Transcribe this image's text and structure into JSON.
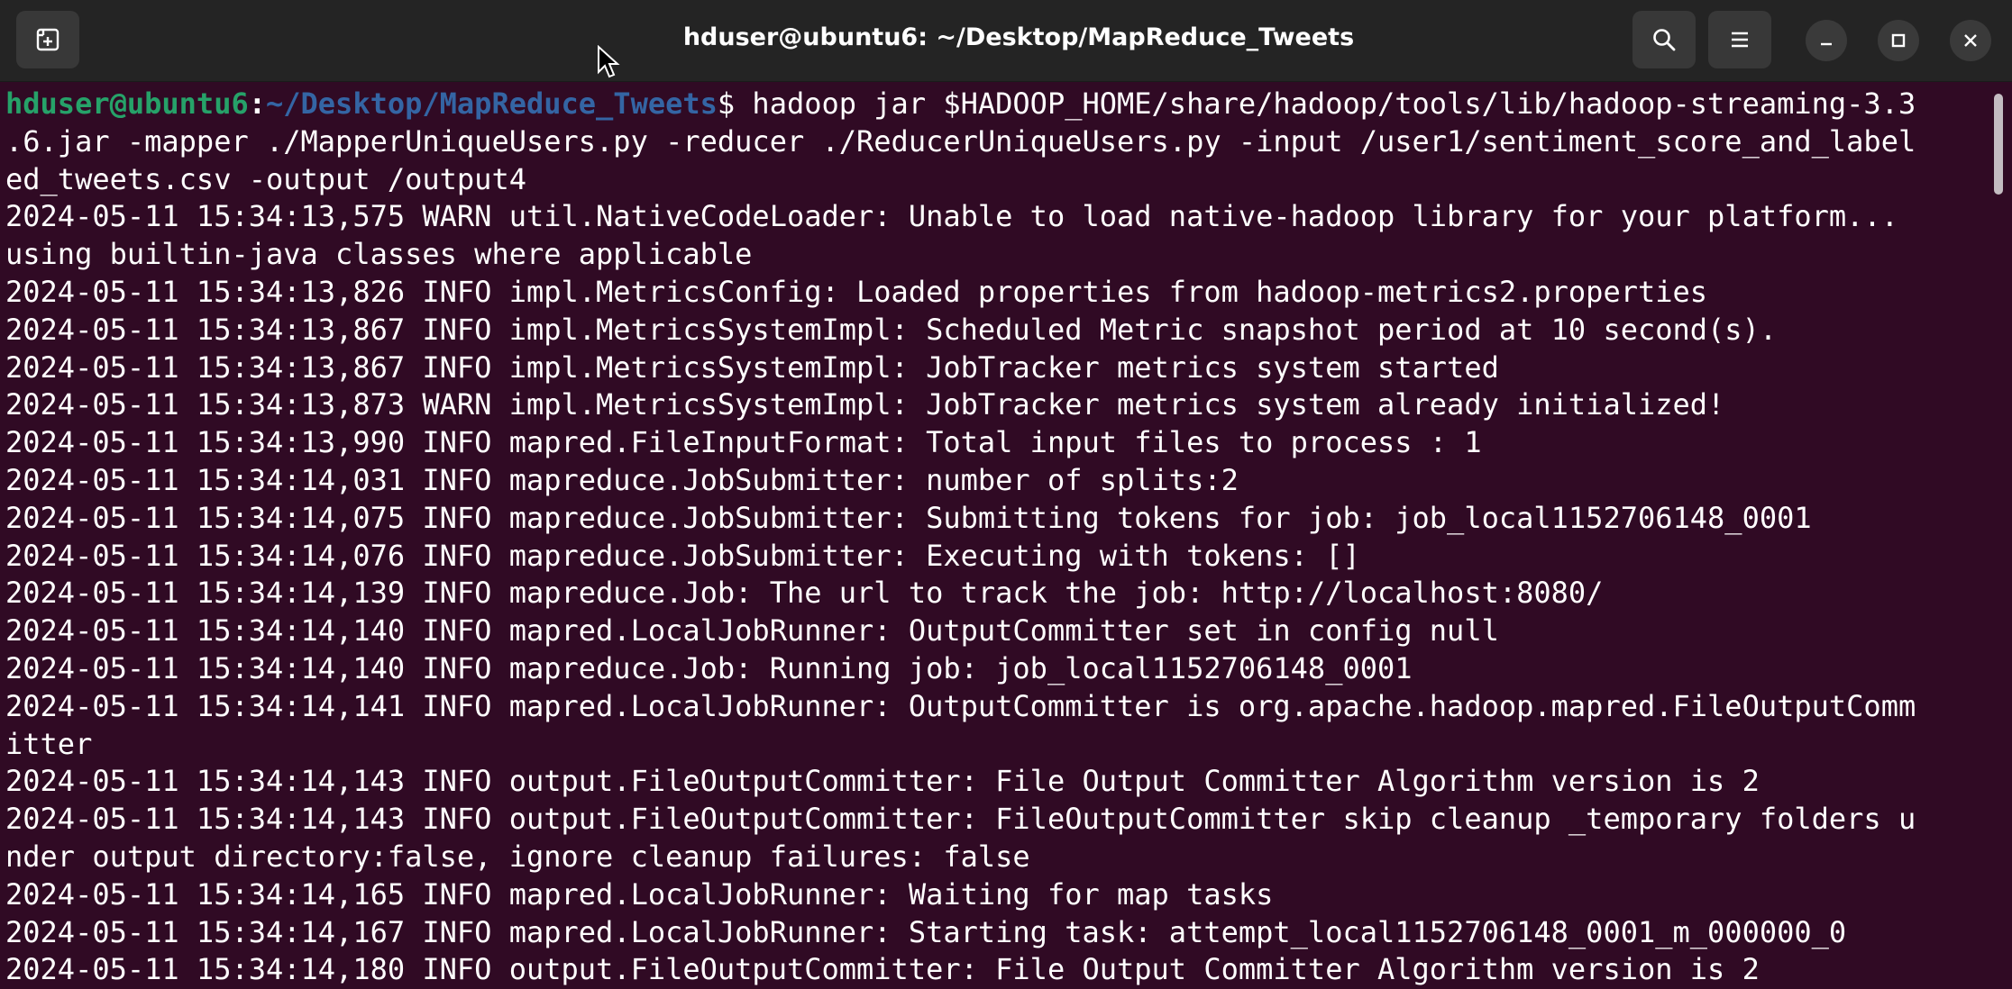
{
  "window": {
    "title": "hduser@ubuntu6: ~/Desktop/MapReduce_Tweets",
    "icons": {
      "new_tab": "new-tab-icon",
      "search": "search-icon",
      "menu": "hamburger-menu-icon",
      "minimize": "minimize-icon",
      "maximize": "maximize-icon",
      "close": "close-icon"
    }
  },
  "colors": {
    "background": "#300a24",
    "headerbar": "#242424",
    "prompt_user": "#26a269",
    "prompt_path": "#3465a4",
    "text": "#ffffff"
  },
  "prompt": {
    "user_host": "hduser@ubuntu6",
    "colon": ":",
    "path": "~/Desktop/MapReduce_Tweets",
    "symbol": "$ ",
    "command_first": "hadoop jar $HADOOP_HOME/share/hadoop/tools/lib/hadoop-streaming-3.3"
  },
  "lines": [
    ".6.jar -mapper ./MapperUniqueUsers.py -reducer ./ReducerUniqueUsers.py -input /user1/sentiment_score_and_label",
    "ed_tweets.csv -output /output4",
    "2024-05-11 15:34:13,575 WARN util.NativeCodeLoader: Unable to load native-hadoop library for your platform...",
    "using builtin-java classes where applicable",
    "2024-05-11 15:34:13,826 INFO impl.MetricsConfig: Loaded properties from hadoop-metrics2.properties",
    "2024-05-11 15:34:13,867 INFO impl.MetricsSystemImpl: Scheduled Metric snapshot period at 10 second(s).",
    "2024-05-11 15:34:13,867 INFO impl.MetricsSystemImpl: JobTracker metrics system started",
    "2024-05-11 15:34:13,873 WARN impl.MetricsSystemImpl: JobTracker metrics system already initialized!",
    "2024-05-11 15:34:13,990 INFO mapred.FileInputFormat: Total input files to process : 1",
    "2024-05-11 15:34:14,031 INFO mapreduce.JobSubmitter: number of splits:2",
    "2024-05-11 15:34:14,075 INFO mapreduce.JobSubmitter: Submitting tokens for job: job_local1152706148_0001",
    "2024-05-11 15:34:14,076 INFO mapreduce.JobSubmitter: Executing with tokens: []",
    "2024-05-11 15:34:14,139 INFO mapreduce.Job: The url to track the job: http://localhost:8080/",
    "2024-05-11 15:34:14,140 INFO mapred.LocalJobRunner: OutputCommitter set in config null",
    "2024-05-11 15:34:14,140 INFO mapreduce.Job: Running job: job_local1152706148_0001",
    "2024-05-11 15:34:14,141 INFO mapred.LocalJobRunner: OutputCommitter is org.apache.hadoop.mapred.FileOutputComm",
    "itter",
    "2024-05-11 15:34:14,143 INFO output.FileOutputCommitter: File Output Committer Algorithm version is 2",
    "2024-05-11 15:34:14,143 INFO output.FileOutputCommitter: FileOutputCommitter skip cleanup _temporary folders u",
    "nder output directory:false, ignore cleanup failures: false",
    "2024-05-11 15:34:14,165 INFO mapred.LocalJobRunner: Waiting for map tasks",
    "2024-05-11 15:34:14,167 INFO mapred.LocalJobRunner: Starting task: attempt_local1152706148_0001_m_000000_0",
    "2024-05-11 15:34:14,180 INFO output.FileOutputCommitter: File Output Committer Algorithm version is 2"
  ]
}
